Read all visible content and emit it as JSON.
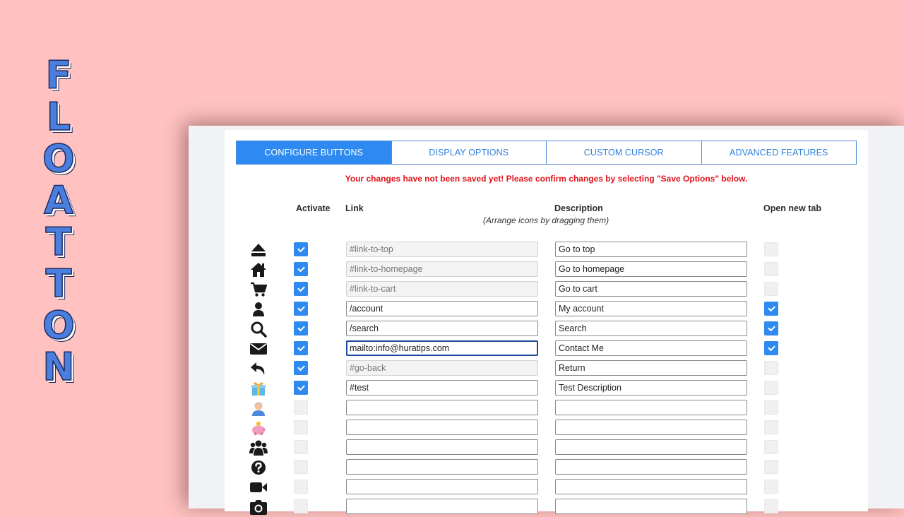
{
  "brand": {
    "letters": [
      "F",
      "L",
      "O",
      "A",
      "T",
      "T",
      "O",
      "N"
    ],
    "color": "#4a7fe0"
  },
  "tabs": [
    {
      "label": "CONFIGURE BUTTONS",
      "active": true
    },
    {
      "label": "DISPLAY OPTIONS",
      "active": false
    },
    {
      "label": "CUSTOM CURSOR",
      "active": false
    },
    {
      "label": "ADVANCED FEATURES",
      "active": false
    }
  ],
  "warning": "Your changes have not been saved yet! Please confirm changes by selecting \"Save Options\" below.",
  "headers": {
    "activate": "Activate",
    "link": "Link",
    "description": "Description",
    "newtab": "Open new tab",
    "arrange_hint": "(Arrange icons by dragging them)"
  },
  "colors": {
    "accent": "#2e8af0",
    "warning": "#e0131a",
    "background": "#ffc2c0"
  },
  "rows": [
    {
      "icon": "eject-icon",
      "active": true,
      "link": "#link-to-top",
      "link_disabled": true,
      "description": "Go to top",
      "newtab": false
    },
    {
      "icon": "home-icon",
      "active": true,
      "link": "#link-to-homepage",
      "link_disabled": true,
      "description": "Go to homepage",
      "newtab": false
    },
    {
      "icon": "cart-icon",
      "active": true,
      "link": "#link-to-cart",
      "link_disabled": true,
      "description": "Go to cart",
      "newtab": false
    },
    {
      "icon": "user-icon",
      "active": true,
      "link": "/account",
      "link_disabled": false,
      "description": "My account",
      "newtab": true
    },
    {
      "icon": "search-icon",
      "active": true,
      "link": "/search",
      "link_disabled": false,
      "description": "Search",
      "newtab": true
    },
    {
      "icon": "envelope-icon",
      "active": true,
      "link": "mailto:info@huratips.com",
      "link_disabled": false,
      "focused": true,
      "description": "Contact Me",
      "newtab": true
    },
    {
      "icon": "reply-icon",
      "active": true,
      "link": "#go-back",
      "link_disabled": true,
      "description": "Return",
      "newtab": false
    },
    {
      "icon": "gift-icon",
      "active": true,
      "link": "#test",
      "link_disabled": false,
      "description": "Test Description",
      "newtab": false
    },
    {
      "icon": "person-avatar-icon",
      "active": false,
      "link": "",
      "link_disabled": false,
      "description": "",
      "newtab": false
    },
    {
      "icon": "piggy-bank-icon",
      "active": false,
      "link": "",
      "link_disabled": false,
      "description": "",
      "newtab": false
    },
    {
      "icon": "users-icon",
      "active": false,
      "link": "",
      "link_disabled": false,
      "description": "",
      "newtab": false
    },
    {
      "icon": "question-icon",
      "active": false,
      "link": "",
      "link_disabled": false,
      "description": "",
      "newtab": false
    },
    {
      "icon": "video-camera-icon",
      "active": false,
      "link": "",
      "link_disabled": false,
      "description": "",
      "newtab": false
    },
    {
      "icon": "camera-icon",
      "active": false,
      "link": "",
      "link_disabled": false,
      "description": "",
      "newtab": false
    }
  ]
}
